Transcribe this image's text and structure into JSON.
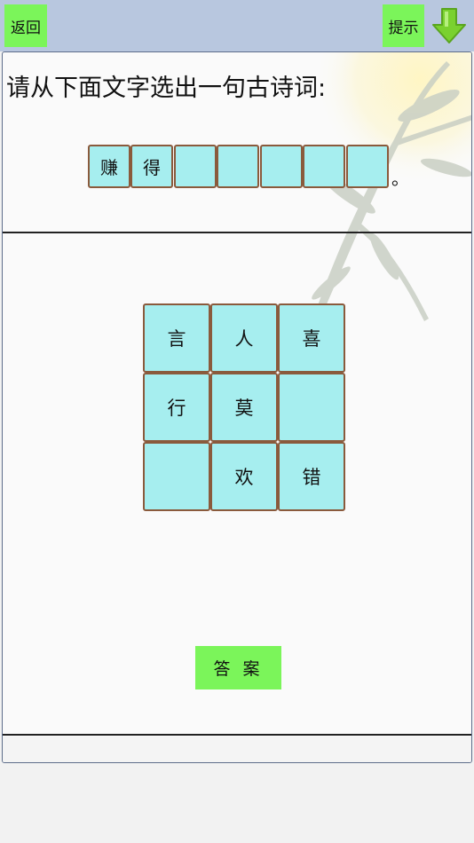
{
  "topbar": {
    "back_label": "返回",
    "hint_label": "提示",
    "icon": "download-arrow-icon"
  },
  "question": {
    "prompt": "请从下面文字选出一句古诗词:",
    "slots": [
      "赚",
      "得",
      "",
      "",
      "",
      "",
      ""
    ],
    "end_punct": "。"
  },
  "grid": {
    "cells": [
      "言",
      "人",
      "喜",
      "行",
      "莫",
      "",
      "",
      "欢",
      "错"
    ]
  },
  "answer_button_label": "答 案",
  "colors": {
    "topbar": "#b8c7df",
    "button_green": "#7bf55a",
    "tile_fill": "#a6eeef",
    "tile_border": "#8a5a3c"
  }
}
